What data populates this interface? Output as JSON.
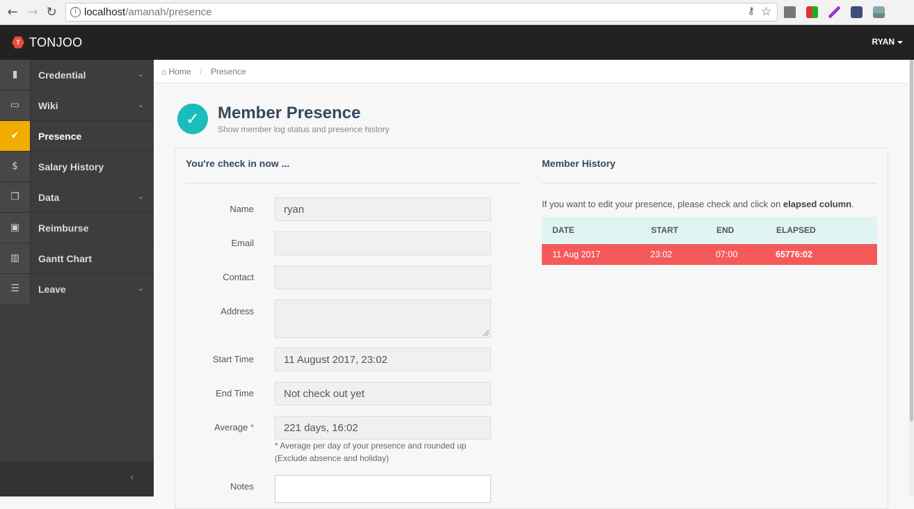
{
  "browser": {
    "url_host": "localhost",
    "url_path": "/amanah/presence",
    "back_icon": "arrow-left-icon",
    "forward_icon": "arrow-right-icon",
    "reload_icon": "reload-icon"
  },
  "header": {
    "brand": "TONJOO",
    "user": "RYAN"
  },
  "sidebar": {
    "items": [
      {
        "label": "Credential",
        "icon": "briefcase-icon",
        "has_submenu": true
      },
      {
        "label": "Wiki",
        "icon": "monitor-icon",
        "has_submenu": true
      },
      {
        "label": "Presence",
        "icon": "check-icon",
        "active": true
      },
      {
        "label": "Salary History",
        "icon": "dollar-icon"
      },
      {
        "label": "Data",
        "icon": "files-icon",
        "has_submenu": true
      },
      {
        "label": "Reimburse",
        "icon": "money-icon"
      },
      {
        "label": "Gantt Chart",
        "icon": "bar-chart-icon"
      },
      {
        "label": "Leave",
        "icon": "list-icon",
        "has_submenu": true
      }
    ],
    "collapse_label": "‹"
  },
  "breadcrumb": {
    "home": "Home",
    "separator": "/",
    "current": "Presence"
  },
  "page": {
    "title": "Member Presence",
    "subtitle": "Show member log status and presence history"
  },
  "checkin": {
    "title": "You're check in now ...",
    "fields": {
      "name_label": "Name",
      "name_value": "ryan",
      "email_label": "Email",
      "email_value": "",
      "contact_label": "Contact",
      "contact_value": "",
      "address_label": "Address",
      "address_value": "",
      "start_label": "Start Time",
      "start_value": "11 August 2017, 23:02",
      "end_label": "End Time",
      "end_value": "Not check out yet",
      "average_label": "Average",
      "average_required": "*",
      "average_value": "221 days, 16:02",
      "average_help_1": "* Average per day of your presence and rounded up",
      "average_help_2": "(Exclude absence and holiday)",
      "notes_label": "Notes",
      "notes_value": ""
    }
  },
  "history": {
    "title": "Member History",
    "note_prefix": "If you want to edit your presence, please check and click on ",
    "note_bold": "elapsed column",
    "note_suffix": ".",
    "columns": [
      "DATE",
      "START",
      "END",
      "ELAPSED"
    ],
    "rows": [
      {
        "date": "11 Aug 2017",
        "start": "23:02",
        "end": "07:00",
        "elapsed": "65776:02"
      }
    ],
    "header_color": "#e0f5f2",
    "row_color": "#f55a5a"
  },
  "colors": {
    "accent": "#1abcbc",
    "active_item": "#f0ad00",
    "brand_red": "#e84c3d"
  }
}
